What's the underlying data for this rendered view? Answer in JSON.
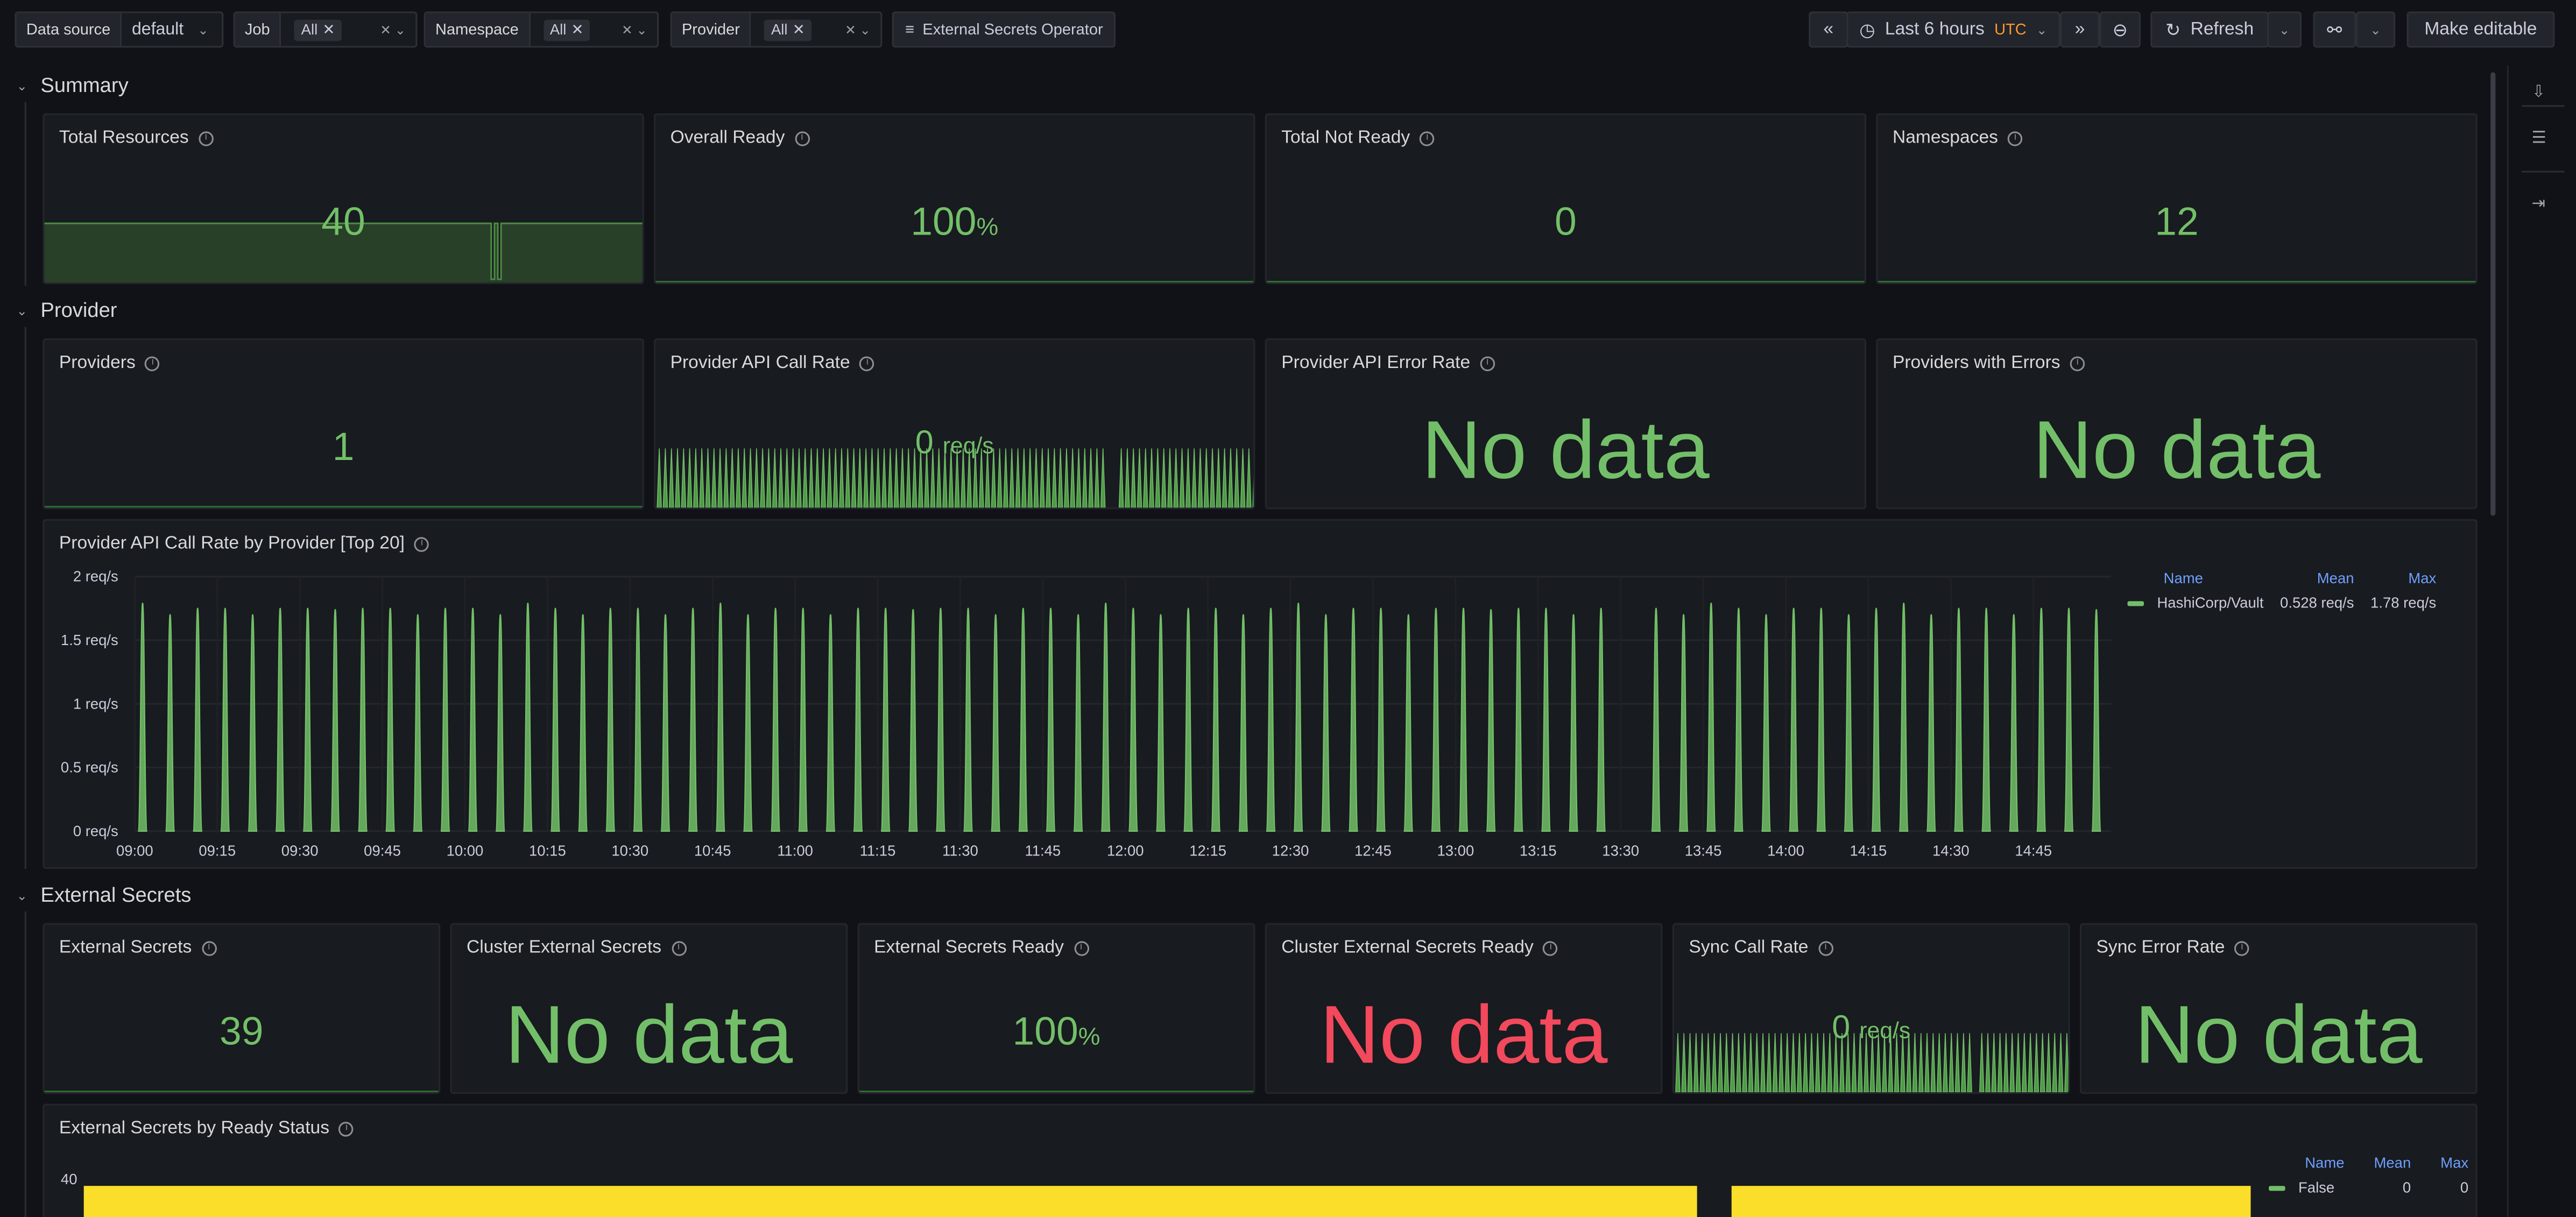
{
  "colors": {
    "green": "#73bf69",
    "red": "#f2495c",
    "yellow": "#fade2a",
    "link": "#6e9fff",
    "accent": "#ff9830"
  },
  "toolbar": {
    "datasource_label": "Data source",
    "datasource_value": "default",
    "job_label": "Job",
    "job_value": "All",
    "namespace_label": "Namespace",
    "namespace_value": "All",
    "provider_label": "Provider",
    "provider_value": "All",
    "link_label": "External Secrets Operator",
    "time_range": "Last 6 hours",
    "timezone": "UTC",
    "refresh_label": "Refresh",
    "edit_label": "Make editable"
  },
  "rows": {
    "summary": "Summary",
    "provider": "Provider",
    "external": "External Secrets"
  },
  "summary": {
    "total_resources": {
      "title": "Total Resources",
      "value": "40"
    },
    "overall_ready": {
      "title": "Overall Ready",
      "value": "100",
      "unit": "%"
    },
    "total_not_ready": {
      "title": "Total Not Ready",
      "value": "0"
    },
    "namespaces": {
      "title": "Namespaces",
      "value": "12"
    }
  },
  "provider": {
    "providers": {
      "title": "Providers",
      "value": "1"
    },
    "api_call_rate": {
      "title": "Provider API Call Rate",
      "value": "0",
      "unit": "req/s"
    },
    "api_error_rate": {
      "title": "Provider API Error Rate",
      "value": "No data"
    },
    "with_errors": {
      "title": "Providers with Errors",
      "value": "No data"
    },
    "timeseries": {
      "title": "Provider API Call Rate by Provider [Top 20]",
      "legend_headers": [
        "Name",
        "Mean",
        "Max"
      ],
      "legend_rows": [
        {
          "name": "HashiCorp/Vault",
          "mean": "0.528 req/s",
          "max": "1.78 req/s"
        }
      ]
    }
  },
  "external": {
    "external_secrets": {
      "title": "External Secrets",
      "value": "39"
    },
    "cluster_external_secrets": {
      "title": "Cluster External Secrets",
      "value": "No data"
    },
    "external_secrets_ready": {
      "title": "External Secrets Ready",
      "value": "100",
      "unit": "%"
    },
    "cluster_ready": {
      "title": "Cluster External Secrets Ready",
      "value": "No data"
    },
    "sync_call_rate": {
      "title": "Sync Call Rate",
      "value": "0",
      "unit": "req/s"
    },
    "sync_error_rate": {
      "title": "Sync Error Rate",
      "value": "No data"
    },
    "by_ready_status": {
      "title": "External Secrets by Ready Status",
      "ytick": "40",
      "legend_headers": [
        "Name",
        "Mean",
        "Max"
      ],
      "legend_rows": [
        {
          "name": "False",
          "mean": "0",
          "max": "0"
        }
      ]
    }
  },
  "chart_data": {
    "type": "area",
    "title": "Provider API Call Rate by Provider [Top 20]",
    "ylabel": "",
    "y_ticks": [
      "0 req/s",
      "0.5 req/s",
      "1 req/s",
      "1.5 req/s",
      "2 req/s"
    ],
    "ylim": [
      0,
      2
    ],
    "x_ticks": [
      "09:00",
      "09:15",
      "09:30",
      "09:45",
      "10:00",
      "10:15",
      "10:30",
      "10:45",
      "11:00",
      "11:15",
      "11:30",
      "11:45",
      "12:00",
      "12:15",
      "12:30",
      "12:45",
      "13:00",
      "13:15",
      "13:30",
      "13:45",
      "14:00",
      "14:15",
      "14:30",
      "14:45"
    ],
    "legend": "right",
    "series": [
      {
        "name": "HashiCorp/Vault",
        "color": "#73bf69",
        "peak": 1.78,
        "mean": 0.528,
        "pattern": "periodic spikes to ~1.75 req/s, gap near 13:30"
      }
    ]
  }
}
